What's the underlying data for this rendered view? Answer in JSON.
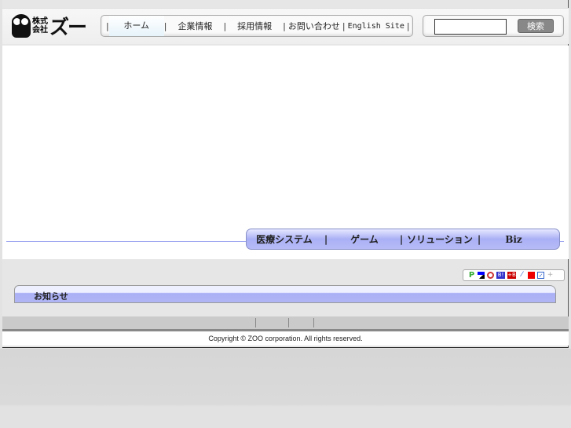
{
  "logo": {
    "kabushiki": "株式",
    "kaisha": "会社",
    "name": "ズー"
  },
  "nav": [
    {
      "label": "ホーム"
    },
    {
      "label": "企業情報"
    },
    {
      "label": "採用情報"
    },
    {
      "label": "お問い合わせ"
    },
    {
      "label": "English Site"
    }
  ],
  "search": {
    "value": "",
    "button": "検索"
  },
  "categories": [
    {
      "label": "医療システム"
    },
    {
      "label": "ゲーム"
    },
    {
      "label": "ソリューション"
    },
    {
      "label": "Biz"
    }
  ],
  "social_icons": [
    "pingoo-icon",
    "delicious-icon",
    "buzzurl-icon",
    "hatena-bookmark-icon",
    "livedoor-clip-icon",
    "clip-icon",
    "fc2-bookmark-icon",
    "check-icon",
    "add-icon"
  ],
  "news": {
    "title": "お知らせ"
  },
  "footer": {
    "copyright": "Copyright © ZOO corporation. All rights reserved."
  }
}
